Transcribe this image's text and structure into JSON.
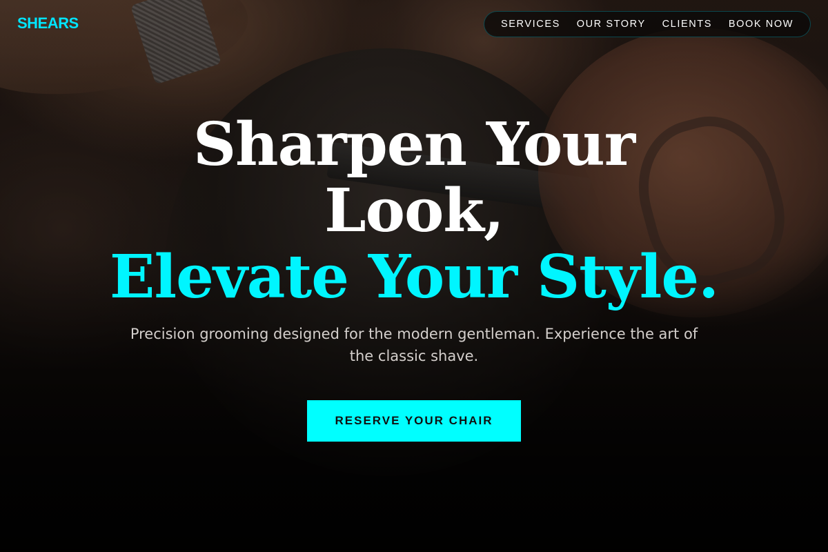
{
  "brand": {
    "name": "SHEARS",
    "accent_color": "#00FFFF"
  },
  "nav": {
    "items": [
      {
        "label": "SERVICES"
      },
      {
        "label": "OUR STORY"
      },
      {
        "label": "CLIENTS"
      },
      {
        "label": "BOOK NOW"
      }
    ]
  },
  "hero": {
    "headline_line1": "Sharpen Your",
    "headline_line2": "Look,",
    "headline_line3": "Elevate Your Style.",
    "subtitle": "Precision grooming designed for the modern gentleman. Experience the art of the classic shave.",
    "cta_label": "RESERVE YOUR CHAIR"
  }
}
